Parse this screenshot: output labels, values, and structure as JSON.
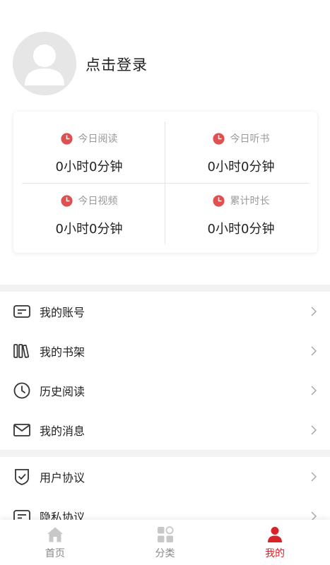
{
  "profile": {
    "login_text": "点击登录"
  },
  "stats": [
    {
      "label": "今日阅读",
      "value": "0小时0分钟",
      "icon": "clock-icon"
    },
    {
      "label": "今日听书",
      "value": "0小时0分钟",
      "icon": "clock-icon"
    },
    {
      "label": "今日视频",
      "value": "0小时0分钟",
      "icon": "clock-icon"
    },
    {
      "label": "累计时长",
      "value": "0小时0分钟",
      "icon": "clock-icon"
    }
  ],
  "menu_group_1": [
    {
      "label": "我的账号",
      "icon": "account-card-icon"
    },
    {
      "label": "我的书架",
      "icon": "bookshelf-icon"
    },
    {
      "label": "历史阅读",
      "icon": "history-clock-icon"
    },
    {
      "label": "我的消息",
      "icon": "mail-icon"
    }
  ],
  "menu_group_2": [
    {
      "label": "用户协议",
      "icon": "shield-check-icon"
    },
    {
      "label": "隐私协议",
      "icon": "privacy-card-icon"
    }
  ],
  "tabbar": [
    {
      "label": "首页",
      "icon": "home-icon",
      "active": false
    },
    {
      "label": "分类",
      "icon": "category-icon",
      "active": false
    },
    {
      "label": "我的",
      "icon": "user-icon",
      "active": true
    }
  ],
  "colors": {
    "accent": "#d8232a",
    "stat_icon": "#e05050",
    "muted_icon": "#c8c8c8"
  }
}
